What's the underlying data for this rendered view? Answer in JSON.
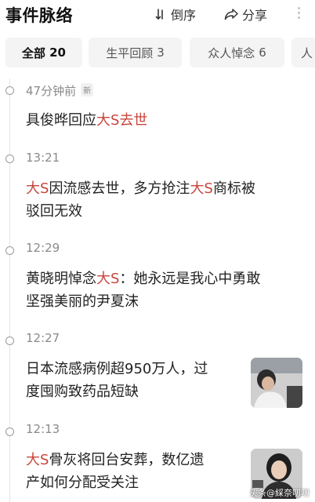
{
  "header": {
    "title": "事件脉络",
    "sort_label": "倒序",
    "share_label": "分享",
    "sort_icon": "sort-icon",
    "share_icon": "share-icon",
    "more_icon": "more-vertical-icon"
  },
  "tabs": [
    {
      "label": "全部",
      "count": "20",
      "active": true
    },
    {
      "label": "生平回顾",
      "count": "3",
      "active": false
    },
    {
      "label": "众人悼念",
      "count": "6",
      "active": false
    },
    {
      "label": "人",
      "count": "",
      "active": false
    }
  ],
  "events": [
    {
      "time": "47分钟前",
      "badge": "新",
      "parts": [
        [
          "具俊晔回应",
          false
        ],
        [
          "大S",
          true
        ],
        [
          "去世",
          false
        ]
      ]
    },
    {
      "time": "13:21",
      "badge": "",
      "parts": [
        [
          "大S",
          true
        ],
        [
          "因流感",
          false
        ],
        [
          "去世",
          true
        ],
        [
          "，多方抢注",
          false
        ],
        [
          "大S",
          true
        ],
        [
          "商标被",
          false
        ]
      ],
      "line2": "驳回无效"
    },
    {
      "time": "12:29",
      "badge": "",
      "parts": [
        [
          "黄晓明悼念",
          false
        ],
        [
          "大S",
          true
        ],
        [
          "：她永远是我心中勇敢",
          false
        ]
      ],
      "line2": "坚强美丽的尹夏沫"
    },
    {
      "time": "12:27",
      "badge": "",
      "parts": [
        [
          "日本流感病例超950万人，过",
          false
        ]
      ],
      "line2": "度囤购致药品短缺",
      "thumb": true
    },
    {
      "time": "12:13",
      "badge": "",
      "parts": [
        [
          "大S",
          true
        ],
        [
          "骨灰将回台安葬，数亿遗",
          false
        ]
      ],
      "line2": "产如何分配受关注",
      "thumb": true
    }
  ],
  "colors": {
    "highlight": "#c8463c",
    "muted": "#8a8a8a",
    "tab_bg": "#f4f4f4"
  },
  "watermark": "头条@綵奈叨叨"
}
